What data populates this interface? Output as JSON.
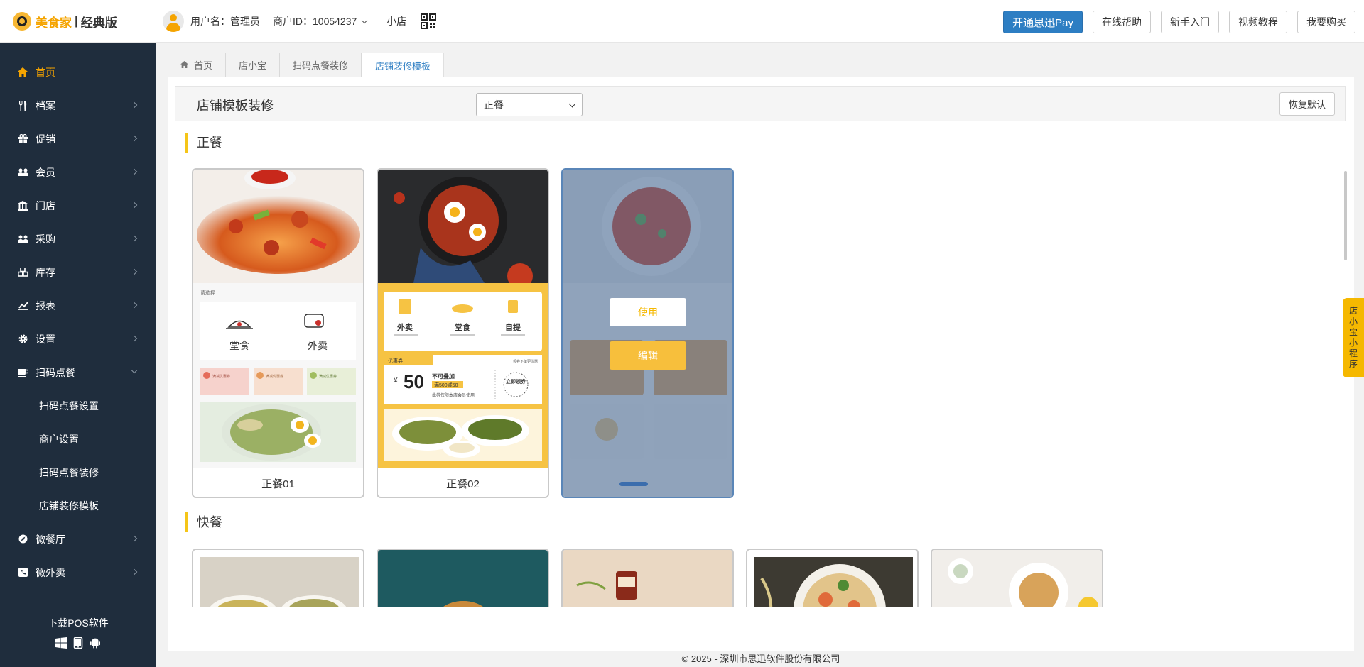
{
  "brand": {
    "name": "美食家",
    "separator": "|",
    "edition": "经典版"
  },
  "user": {
    "username_label": "用户名：管理员",
    "merchant_label": "商户ID：10054237",
    "shop": "小店"
  },
  "top_buttons": [
    "开通思迅Pay",
    "在线帮助",
    "新手入门",
    "视频教程",
    "我要购买"
  ],
  "sidebar": {
    "items": [
      {
        "label": "首页",
        "icon": "home-icon"
      },
      {
        "label": "档案",
        "icon": "utensils-icon"
      },
      {
        "label": "促销",
        "icon": "gift-icon"
      },
      {
        "label": "会员",
        "icon": "users-icon"
      },
      {
        "label": "门店",
        "icon": "bank-icon"
      },
      {
        "label": "采购",
        "icon": "users-icon"
      },
      {
        "label": "库存",
        "icon": "cubes-icon"
      },
      {
        "label": "报表",
        "icon": "chart-icon"
      },
      {
        "label": "设置",
        "icon": "gear-icon"
      },
      {
        "label": "扫码点餐",
        "icon": "coffee-icon"
      },
      {
        "label": "微餐厅",
        "icon": "compass-icon"
      },
      {
        "label": "微外卖",
        "icon": "phone-icon"
      }
    ],
    "sub_items": [
      "扫码点餐设置",
      "商户设置",
      "扫码点餐装修",
      "店铺装修模板"
    ],
    "download": "下载POS软件"
  },
  "tabs": [
    "首页",
    "店小宝",
    "扫码点餐装修",
    "店铺装修模板"
  ],
  "header": {
    "title": "店铺模板装修",
    "select_value": "正餐",
    "restore": "恢复默认"
  },
  "sections": [
    {
      "title": "正餐",
      "cards": [
        {
          "name": "正餐01",
          "prompt": "请选择",
          "option1": "堂食",
          "option2": "外卖",
          "coupons": [
            "满减优惠券",
            "满减优惠券",
            "满减优惠券"
          ]
        },
        {
          "name": "正餐02",
          "services": [
            "外卖",
            "堂食",
            "自提"
          ],
          "coupon_tag": "优惠券",
          "coupon_corner": "领券下单更优惠",
          "coupon_currency": "¥",
          "coupon_amount": "50",
          "coupon_title": "不可叠加",
          "coupon_rule": "满500减50",
          "coupon_note": "此券仅限本店会员使用",
          "coupon_action": "立即领券"
        },
        {
          "name": "",
          "use": "使用",
          "edit": "编辑"
        }
      ]
    },
    {
      "title": "快餐"
    }
  ],
  "float_tab": [
    "店",
    "小",
    "宝",
    "小",
    "程",
    "序"
  ],
  "footer": "© 2025 - 深圳市思迅软件股份有限公司"
}
